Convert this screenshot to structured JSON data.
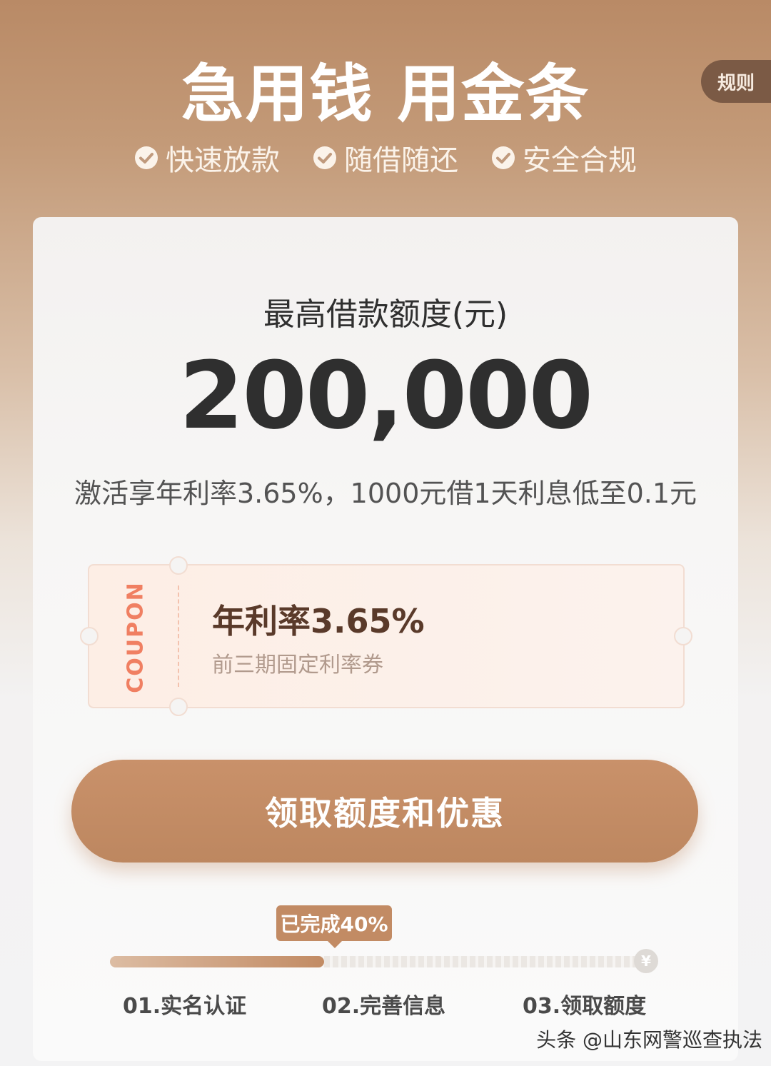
{
  "header": {
    "rules_label": "规则",
    "title": "急用钱 用金条",
    "features": [
      "快速放款",
      "随借随还",
      "安全合规"
    ]
  },
  "card": {
    "limit_label": "最高借款额度(元)",
    "limit_amount": "200,000",
    "promo_text": "激活享年利率3.65%，1000元借1天利息低至0.1元"
  },
  "coupon": {
    "tag": "COUPON",
    "rate": "年利率3.65%",
    "description": "前三期固定利率券"
  },
  "cta": {
    "label": "领取额度和优惠"
  },
  "progress": {
    "badge": "已完成40%",
    "fraction": 0.4,
    "end_icon": "yuan-icon",
    "end_glyph": "¥",
    "steps": [
      "01.实名认证",
      "02.完善信息",
      "03.领取额度"
    ]
  },
  "watermark": {
    "text": "头条 @山东网警巡查执法"
  },
  "colors": {
    "accent": "#c28b64",
    "coupon_tag": "#f07f62",
    "rules_bg": "#7b5a45"
  }
}
